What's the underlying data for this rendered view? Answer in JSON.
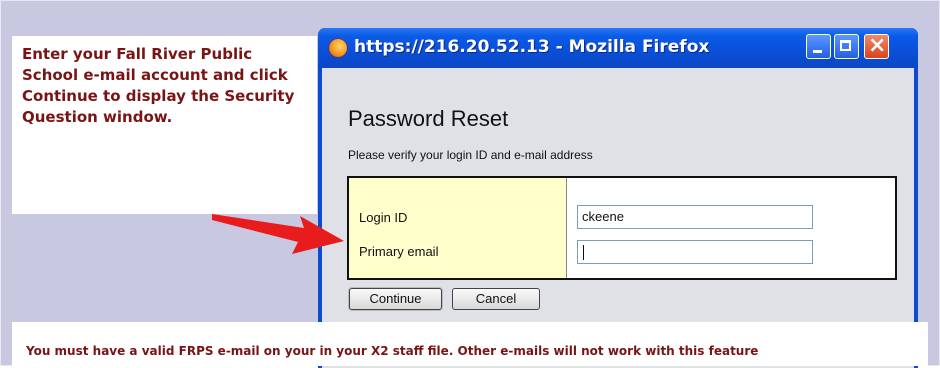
{
  "instruction": {
    "text": "Enter your Fall River Public School e-mail account and click Continue to display the Security Question window."
  },
  "window": {
    "title": "https://216.20.52.13 - Mozilla Firefox",
    "controls": {
      "minimize_icon": "minimize-icon",
      "maximize_icon": "maximize-icon",
      "close_glyph": "×"
    }
  },
  "page": {
    "heading": "Password Reset",
    "subheading": "Please verify your login ID and e-mail address",
    "form": {
      "login_label": "Login ID",
      "login_value": "ckeene",
      "email_label": "Primary email",
      "email_value": ""
    },
    "buttons": {
      "continue_label": "Continue",
      "cancel_label": "Cancel"
    }
  },
  "note": {
    "text": "You must have a valid FRPS e-mail on your in your X2 staff file.  Other e-mails will not work with this feature"
  },
  "colors": {
    "annotation_text": "#7a1414",
    "window_frame": "#0a4bd4",
    "label_column": "#ffffcc",
    "arrow": "#e81c1c",
    "background": "#c8c8e0"
  }
}
